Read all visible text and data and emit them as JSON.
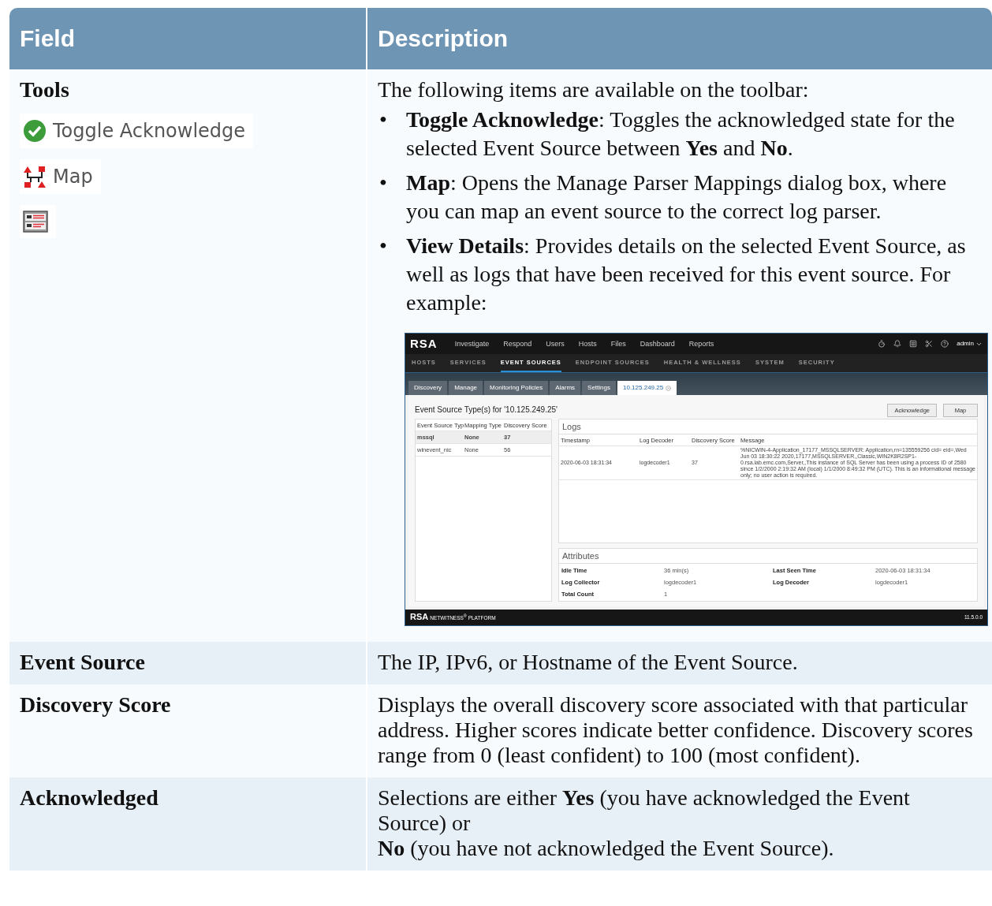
{
  "table": {
    "columns": [
      "Field",
      "Description"
    ],
    "rows": [
      {
        "kind": "tools",
        "field": "Tools",
        "tools": [
          {
            "kind": "acknowledge",
            "label": "Toggle Acknowledge"
          },
          {
            "kind": "map",
            "label": "Map"
          },
          {
            "kind": "details"
          }
        ],
        "intro": "The following items are available on the toolbar:",
        "bullet_marker": "•",
        "bullets": [
          "**Toggle Acknowledge**: Toggles the acknowledged state for the selected Event Source between **Yes** and **No**.",
          "**Map**: Opens the Manage Parser Mappings dialog box, where you can map an event source to the correct log parser.",
          "**View Details**: Provides details on the selected Event Source, as well as logs that have been received for this event source. For example:"
        ],
        "example": {
          "brand": "RSA",
          "nav": [
            "Investigate",
            "Respond",
            "Users",
            "Hosts",
            "Files",
            "Dashboard",
            "Reports"
          ],
          "user": "admin",
          "subnav": [
            {
              "label": "HOSTS",
              "selected": false
            },
            {
              "label": "SERVICES",
              "selected": false
            },
            {
              "label": "EVENT SOURCES",
              "selected": true
            },
            {
              "label": "ENDPOINT SOURCES",
              "selected": false
            },
            {
              "label": "HEALTH & WELLNESS",
              "selected": false
            },
            {
              "label": "SYSTEM",
              "selected": false
            },
            {
              "label": "SECURITY",
              "selected": false
            }
          ],
          "tabs": [
            {
              "label": "Discovery",
              "selected": false
            },
            {
              "label": "Manage",
              "selected": false
            },
            {
              "label": "Monitoring Policies",
              "selected": false
            },
            {
              "label": "Alarms",
              "selected": false
            },
            {
              "label": "Settings",
              "selected": false
            },
            {
              "label": "10.125.249.25",
              "selected": true
            }
          ],
          "heading": "Event Source Type(s) for '10.125.249.25'",
          "buttons": [
            "Acknowledge",
            "Map"
          ],
          "types_table": {
            "columns": [
              "Event Source Typ",
              "Mapping Type",
              "Discovery Score"
            ],
            "rows": [
              {
                "cells": [
                  "mssql",
                  "None",
                  "37"
                ],
                "selected": true
              },
              {
                "cells": [
                  "winevent_nic",
                  "None",
                  "56"
                ],
                "selected": false
              }
            ]
          },
          "logs": {
            "title": "Logs",
            "columns": [
              "Timestamp",
              "Log Decoder",
              "Discovery Score",
              "Message"
            ],
            "rows": [
              [
                "2020-06-03 18:31:34",
                "logdecoder1",
                "37",
                "%NICWIN-4-Application_17177_MSSQLSERVER: Application,rn=135559256 cid= eid=,Wed Jun 03 18:30:22 2020,17177,MSSQLSERVER,,Classic,WIN2K8R2SP1-0.rsa.lab.emc.com,Server,,This instance of SQL Server has been using a process ID of 2580 since 1/2/2000 2:19:32 AM (local) 1/1/2000 8:49:32 PM (UTC). This is an informational message only; no user action is required."
              ]
            ]
          },
          "attributes": {
            "title": "Attributes",
            "items": [
              {
                "label": "Idle Time",
                "value": "36 min(s)"
              },
              {
                "label": "Last Seen Time",
                "value": "2020-06-03 18:31:34"
              },
              {
                "label": "Log Collector",
                "value": "logdecoder1"
              },
              {
                "label": "Log Decoder",
                "value": "logdecoder1"
              },
              {
                "label": "Total Count",
                "value": "1"
              }
            ]
          },
          "footer": {
            "brand": "RSA",
            "product": "NETWITNESS$^{®}$ PLATFORM",
            "version": "11.5.0.0"
          }
        }
      },
      {
        "kind": "text",
        "field": "Event Source",
        "lines": [
          "The IP, IPv6, or Hostname of the Event Source."
        ]
      },
      {
        "kind": "text",
        "field": "Discovery Score",
        "lines": [
          "Displays the overall discovery score associated with that particular address. Higher scores indicate better confidence. Discovery scores range from 0 (least confident) to 100 (most confident)."
        ]
      },
      {
        "kind": "text",
        "field": "Acknowledged",
        "lines": [
          "Selections are either **Yes** (you have acknowledged the Event Source) or",
          "**No** (you have not acknowledged the Event Source)."
        ]
      }
    ]
  }
}
